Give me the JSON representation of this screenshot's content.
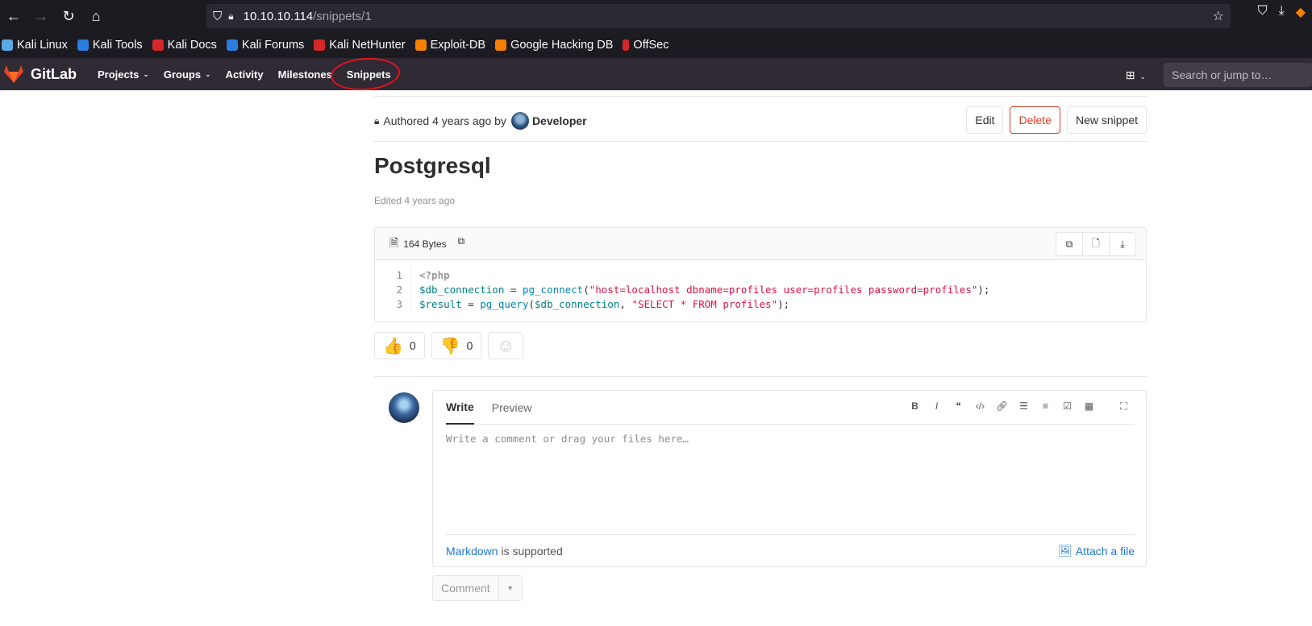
{
  "browser": {
    "url_host": "10.10.10.114",
    "url_path": "/snippets/1",
    "bookmarks": [
      {
        "label": "Kali Linux",
        "color": "#5aa9e6"
      },
      {
        "label": "Kali Tools",
        "color": "#2d7de0"
      },
      {
        "label": "Kali Docs",
        "color": "#d62828"
      },
      {
        "label": "Kali Forums",
        "color": "#2d7de0"
      },
      {
        "label": "Kali NetHunter",
        "color": "#d62828"
      },
      {
        "label": "Exploit-DB",
        "color": "#f77f00"
      },
      {
        "label": "Google Hacking DB",
        "color": "#f77f00"
      },
      {
        "label": "OffSec",
        "color": "#d62828"
      }
    ]
  },
  "gitlab": {
    "brand": "GitLab",
    "nav": {
      "projects": "Projects",
      "groups": "Groups",
      "activity": "Activity",
      "milestones": "Milestones",
      "snippets": "Snippets"
    },
    "search_placeholder": "Search or jump to…"
  },
  "snippet": {
    "authored_prefix": "Authored 4 years ago by",
    "author": "Developer",
    "actions": {
      "edit": "Edit",
      "delete": "Delete",
      "new": "New snippet"
    },
    "title": "Postgresql",
    "edited": "Edited 4 years ago",
    "file_size": "164 Bytes",
    "line_numbers": [
      "1",
      "2",
      "3"
    ],
    "code": {
      "l1": "<?php",
      "l2_var": "$db_connection",
      "l2_op": " = ",
      "l2_fn": "pg_connect",
      "l2_open": "(",
      "l2_str": "\"host=localhost dbname=profiles user=profiles password=profiles\"",
      "l2_close": ");",
      "l3_var": "$result",
      "l3_op": " = ",
      "l3_fn": "pg_query",
      "l3_open": "(",
      "l3_arg": "$db_connection",
      "l3_sep": ", ",
      "l3_str": "\"SELECT * FROM profiles\"",
      "l3_close": ");"
    }
  },
  "reactions": {
    "thumbs_up": "0",
    "thumbs_down": "0"
  },
  "comment": {
    "tab_write": "Write",
    "tab_preview": "Preview",
    "placeholder": "Write a comment or drag your files here…",
    "markdown_link": "Markdown",
    "markdown_suffix": " is supported",
    "attach": "Attach a file",
    "submit": "Comment"
  }
}
